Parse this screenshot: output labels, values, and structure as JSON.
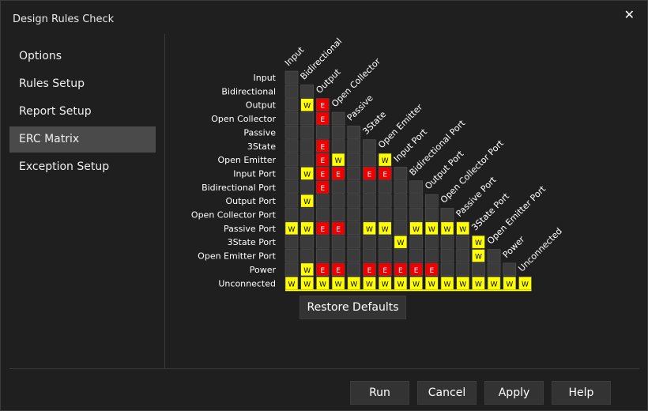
{
  "window": {
    "title": "Design Rules Check"
  },
  "sidebar": {
    "items": [
      {
        "label": "Options"
      },
      {
        "label": "Rules Setup"
      },
      {
        "label": "Report Setup"
      },
      {
        "label": "ERC Matrix",
        "active": true
      },
      {
        "label": "Exception Setup"
      }
    ]
  },
  "matrix": {
    "rows": [
      "Input",
      "Bidirectional",
      "Output",
      "Open Collector",
      "Passive",
      "3State",
      "Open Emitter",
      "Input Port",
      "Bidirectional Port",
      "Output Port",
      "Open Collector Port",
      "Passive Port",
      "3State Port",
      "Open Emitter Port",
      "Power",
      "Unconnected"
    ],
    "columns": [
      "Input",
      "Bidirectional",
      "Output",
      "Open Collector",
      "Passive",
      "3State",
      "Open Emitter",
      "Input Port",
      "Bidirectional Port",
      "Output Port",
      "Open Collector Port",
      "Passive Port",
      "3State Port",
      "Open Emitter Port",
      "Power",
      "Unconnected"
    ],
    "cells": [
      [
        ""
      ],
      [
        "",
        ""
      ],
      [
        "",
        "W",
        "E"
      ],
      [
        "",
        "",
        "E",
        ""
      ],
      [
        "",
        "",
        "",
        "",
        ""
      ],
      [
        "",
        "",
        "E",
        "",
        "",
        ""
      ],
      [
        "",
        "",
        "E",
        "W",
        "",
        "",
        "W"
      ],
      [
        "",
        "W",
        "E",
        "E",
        "",
        "E",
        "E",
        ""
      ],
      [
        "",
        "",
        "E",
        "",
        "",
        "",
        "",
        "",
        ""
      ],
      [
        "",
        "W",
        "",
        "",
        "",
        "",
        "",
        "",
        "",
        ""
      ],
      [
        "",
        "",
        "",
        "",
        "",
        "",
        "",
        "",
        "",
        "",
        ""
      ],
      [
        "W",
        "W",
        "E",
        "E",
        "",
        "W",
        "W",
        "",
        "W",
        "W",
        "W",
        "W"
      ],
      [
        "",
        "",
        "",
        "",
        "",
        "",
        "",
        "W",
        "",
        "",
        "",
        "",
        "W"
      ],
      [
        "",
        "",
        "",
        "",
        "",
        "",
        "",
        "",
        "",
        "",
        "",
        "",
        "W",
        ""
      ],
      [
        "",
        "W",
        "E",
        "E",
        "",
        "E",
        "E",
        "E",
        "E",
        "E",
        "",
        "",
        "",
        "",
        ""
      ],
      [
        "W",
        "W",
        "W",
        "W",
        "W",
        "W",
        "W",
        "W",
        "W",
        "W",
        "W",
        "W",
        "W",
        "W",
        "W",
        "W"
      ]
    ],
    "colors": {
      "W": "#ffff00",
      "E": "#ee0000",
      "empty": "#3b3b3b"
    },
    "restore_label": "Restore Defaults"
  },
  "buttons": {
    "run": "Run",
    "cancel": "Cancel",
    "apply": "Apply",
    "help": "Help"
  }
}
